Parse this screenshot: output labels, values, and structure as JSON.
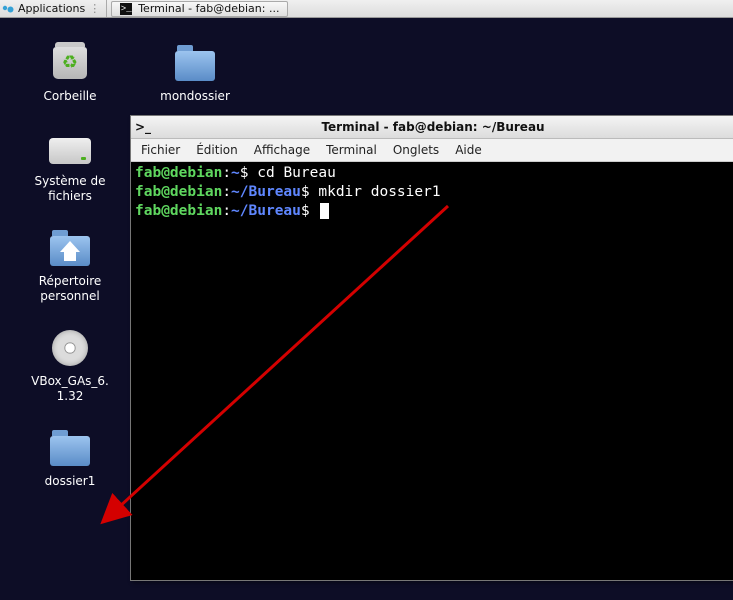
{
  "taskbar": {
    "applications_label": "Applications",
    "task_item_label": "Terminal - fab@debian: ..."
  },
  "desktop_icons_col1": [
    {
      "name": "corbeille",
      "label": "Corbeille",
      "icon": "trash-icon"
    },
    {
      "name": "filesystem",
      "label": "Système de\nfichiers",
      "icon": "drive-icon"
    },
    {
      "name": "home",
      "label": "Répertoire\npersonnel",
      "icon": "home-folder-icon"
    },
    {
      "name": "vbox",
      "label": "VBox_GAs_6.\n1.32",
      "icon": "disc-icon"
    },
    {
      "name": "dossier1",
      "label": "dossier1",
      "icon": "folder-icon"
    }
  ],
  "desktop_icons_col2": [
    {
      "name": "mondossier",
      "label": "mondossier",
      "icon": "folder-icon"
    }
  ],
  "window": {
    "title": "Terminal - fab@debian: ~/Bureau",
    "menu": {
      "fichier": "Fichier",
      "edition": "Édition",
      "affichage": "Affichage",
      "terminal": "Terminal",
      "onglets": "Onglets",
      "aide": "Aide"
    }
  },
  "terminal": {
    "user_host": "fab@debian",
    "sep": ":",
    "home_path": "~",
    "bureau_path": "~/Bureau",
    "prompt": "$",
    "cmd1": "cd Bureau",
    "cmd2": "mkdir dossier1",
    "cmd3": ""
  }
}
